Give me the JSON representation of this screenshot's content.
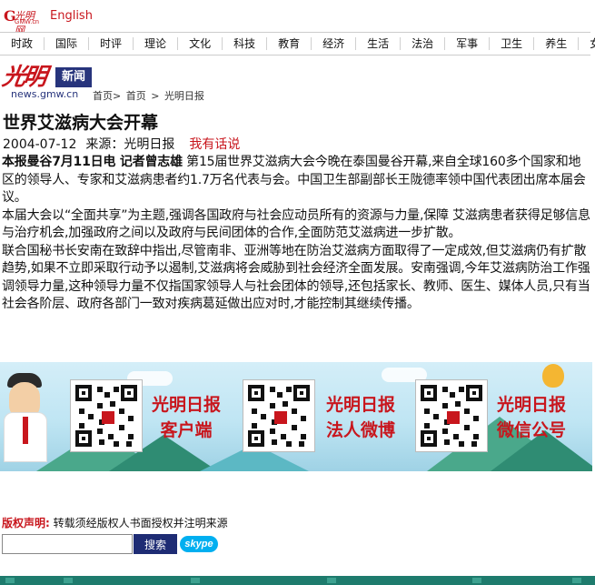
{
  "header": {
    "logo_text": "光明网",
    "logo_sub": "GMW.cn",
    "english_link": "English"
  },
  "nav": {
    "items": [
      "时政",
      "国际",
      "时评",
      "理论",
      "文化",
      "科技",
      "教育",
      "经济",
      "生活",
      "法治",
      "军事",
      "卫生",
      "养生",
      "女人"
    ]
  },
  "brand": {
    "name": "光明",
    "badge": "新闻",
    "domain": "news.gmw.cn",
    "breadcrumb": [
      "首页>",
      "首页",
      ">",
      "光明日报"
    ]
  },
  "article": {
    "title": "世界艾滋病大会开幕",
    "date": "2004-07-12",
    "source": "来源：光明日报",
    "comment_link": "我有话说",
    "lead": "本报曼谷7月11日电 记者曾志雄",
    "p1": " 第15届世界艾滋病大会今晚在泰国曼谷开幕,来自全球160多个国家和地区的领导人、专家和艾滋病患者约1.7万名代表与会。中国卫生部副部长王陇德率领中国代表团出席本届会议。",
    "p2": "本届大会以“全面共享”为主题,强调各国政府与社会应动员所有的资源与力量,保障 艾滋病患者获得足够信息与治疗机会,加强政府之间以及政府与民间团体的合作,全面防范艾滋病进一步扩散。",
    "p3": "联合国秘书长安南在致辞中指出,尽管南非、亚洲等地在防治艾滋病方面取得了一定成效,但艾滋病仍有扩散趋势,如果不立即采取行动予以遏制,艾滋病将会威胁到社会经济全面发展。安南强调,今年艾滋病防治工作强调领导力量,这种领导力量不仅指国家领导人与社会团体的领导,还包括家长、教师、医生、媒体人员,只有当社会各阶层、政府各部门一致对疾病葛延做出应对时,才能控制其继续传播。"
  },
  "banner": {
    "items": [
      {
        "line1": "光明日报",
        "line2": "客户端"
      },
      {
        "line1": "光明日报",
        "line2": "法人微博"
      },
      {
        "line1": "光明日报",
        "line2": "微信公号"
      }
    ]
  },
  "footer": {
    "rights_label": "版权声明:",
    "rights_text": "转载须经版权人书面授权并注明来源",
    "search_placeholder": "",
    "search_button": "搜索",
    "skype_label": "skype"
  },
  "colors": {
    "brand_red": "#c8161d",
    "brand_blue": "#27347c",
    "search_button": "#1e2c74"
  }
}
